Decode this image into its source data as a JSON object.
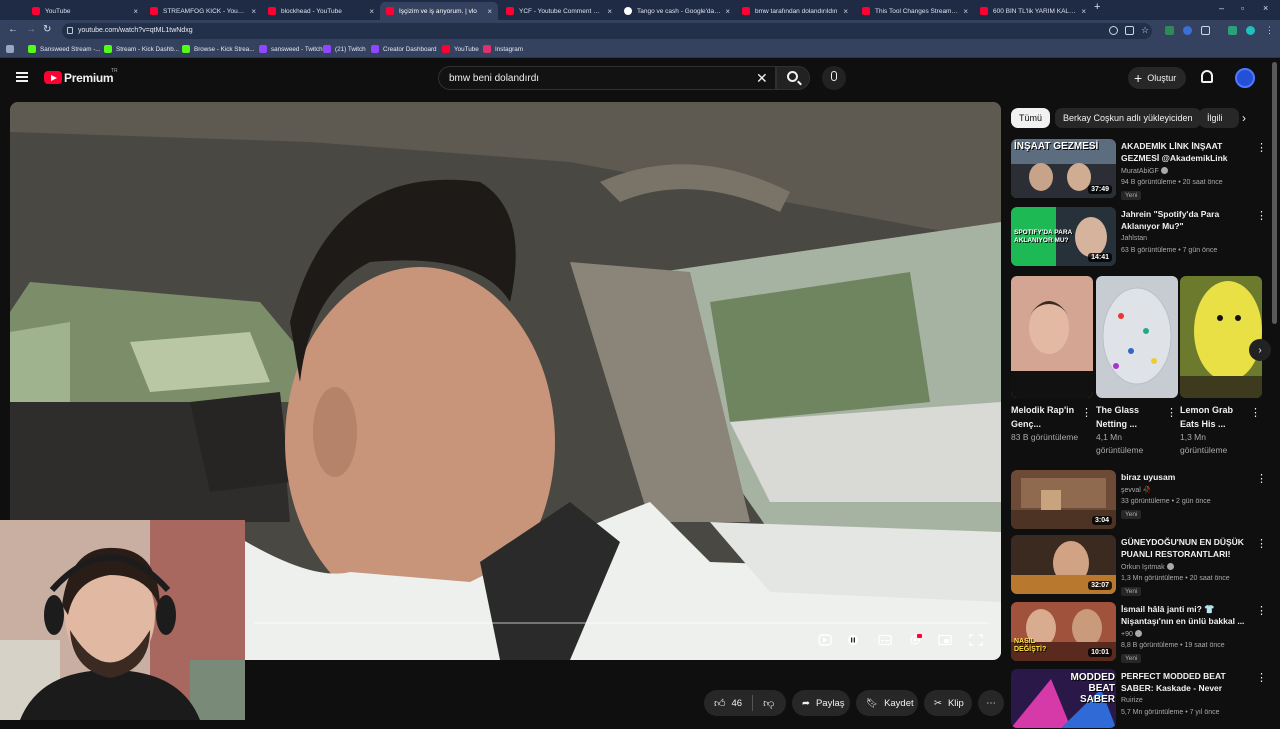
{
  "browser": {
    "tabs": [
      {
        "label": "YouTube",
        "icon": "youtube-favicon"
      },
      {
        "label": "STREAMFOG KICK - YouTube",
        "icon": "youtube-favicon"
      },
      {
        "label": "blockhead - YouTube",
        "icon": "youtube-favicon"
      },
      {
        "label": "İşçizim ve iş arıyorum. | vlo",
        "icon": "youtube-favicon"
      },
      {
        "label": "YCF - Youtube Comment Finder",
        "icon": "youtube-favicon"
      },
      {
        "label": "Tango ve cash - Google'da Ara",
        "icon": "google-favicon"
      },
      {
        "label": "bmw tarafından dolandırıldın",
        "icon": "youtube-favicon"
      },
      {
        "label": "This Tool Changes Streaming F",
        "icon": "youtube-favicon"
      },
      {
        "label": "600 BİN TL'lik YARIM KALAN İŞ",
        "icon": "youtube-favicon"
      }
    ],
    "new_tab": "+",
    "url": "youtube.com/watch?v=qtML1twNdxg",
    "bookmarks": [
      {
        "label": "Sansweed Stream -...",
        "color": "#53fc18"
      },
      {
        "label": "Stream - Kick Dashb...",
        "color": "#53fc18"
      },
      {
        "label": "Browse - Kick Strea...",
        "color": "#53fc18"
      },
      {
        "label": "sansweed - Twitch",
        "color": "#9146ff"
      },
      {
        "label": "(21) Twitch",
        "color": "#9146ff"
      },
      {
        "label": "Creator Dashboard",
        "color": "#9146ff"
      },
      {
        "label": "YouTube",
        "color": "#ff0033"
      },
      {
        "label": "Instagram",
        "color": "#e1306c"
      }
    ]
  },
  "header": {
    "brand": "Premium",
    "region": "TR",
    "search_value": "bmw beni dolandırdı",
    "create_label": "Oluştur"
  },
  "actions": {
    "like_count": "46",
    "share_label": "Paylaş",
    "save_label": "Kaydet",
    "clip_label": "Klip",
    "more": "⋯"
  },
  "chips": [
    "Tümü",
    "Berkay Coşkun adlı yükleyiciden",
    "İlgili"
  ],
  "recommendations_top": [
    {
      "title": "AKADEMİK LİNK İNŞAAT GEZMESİ @AkademikLink",
      "channel": "MuratAbiGF",
      "verified": true,
      "meta": "94 B görüntüleme • 20 saat önce",
      "badge": "Yeni",
      "duration": "37:49",
      "thumb_text": "İNŞAAT GEZMESİ"
    },
    {
      "title": "Jahrein \"Spotify'da Para Aklanıyor Mu?\"",
      "channel": "Jahlstan",
      "verified": false,
      "meta": "63 B görüntüleme • 7 gün önce",
      "badge": "",
      "duration": "14:41",
      "thumb_text": "SPOTIFY'DA PARA AKLANIYOR MU?"
    }
  ],
  "shorts": [
    {
      "title": "Melodik Rap'in Genç...",
      "meta": "83 B görüntüleme"
    },
    {
      "title": "The Glass Netting ...",
      "meta": "4,1 Mn görüntüleme"
    },
    {
      "title": "Lemon Grab Eats His ...",
      "meta": "1,3 Mn görüntüleme"
    }
  ],
  "recommendations_bottom": [
    {
      "title": "biraz uyusam",
      "channel": "şevval 🥀",
      "verified": false,
      "meta": "33 görüntüleme • 2 gün önce",
      "badge": "Yeni",
      "duration": "3:04",
      "thumb_text": ""
    },
    {
      "title": "GÜNEYDOĞU'NUN EN DÜŞÜK PUANLI RESTORANTLARI!",
      "channel": "Orkun Işıtmak",
      "verified": true,
      "meta": "1,3 Mn görüntüleme • 20 saat önce",
      "badge": "Yeni",
      "duration": "32:07",
      "thumb_text": ""
    },
    {
      "title": "İsmail hâlâ janti mi? 👕 Nişantaşı'nın en ünlü bakkal ...",
      "channel": "+90",
      "verified": true,
      "meta": "8,8 B görüntüleme • 19 saat önce",
      "badge": "Yeni",
      "duration": "10:01",
      "thumb_text": "NASIL DEĞİŞTİ?"
    },
    {
      "title": "PERFECT MODDED BEAT SABER: Kaskade - Never Sleep...",
      "channel": "Ruirize",
      "verified": false,
      "meta": "5,7 Mn görüntüleme • 7 yıl önce",
      "badge": "",
      "duration": "",
      "thumb_text": "MODDED BEAT SABER"
    }
  ]
}
